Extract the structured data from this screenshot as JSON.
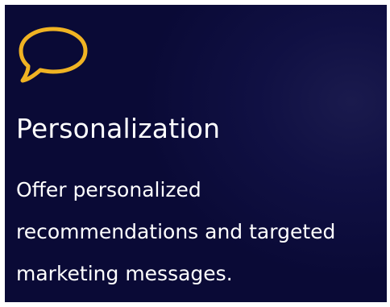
{
  "card": {
    "icon": "speech-bubble-icon",
    "icon_color": "#f0b323",
    "background_color": "#0b0b38",
    "title": "Personalization",
    "description_lines": [
      "Offer personalized",
      "recommendations and targeted",
      "marketing messages."
    ]
  }
}
